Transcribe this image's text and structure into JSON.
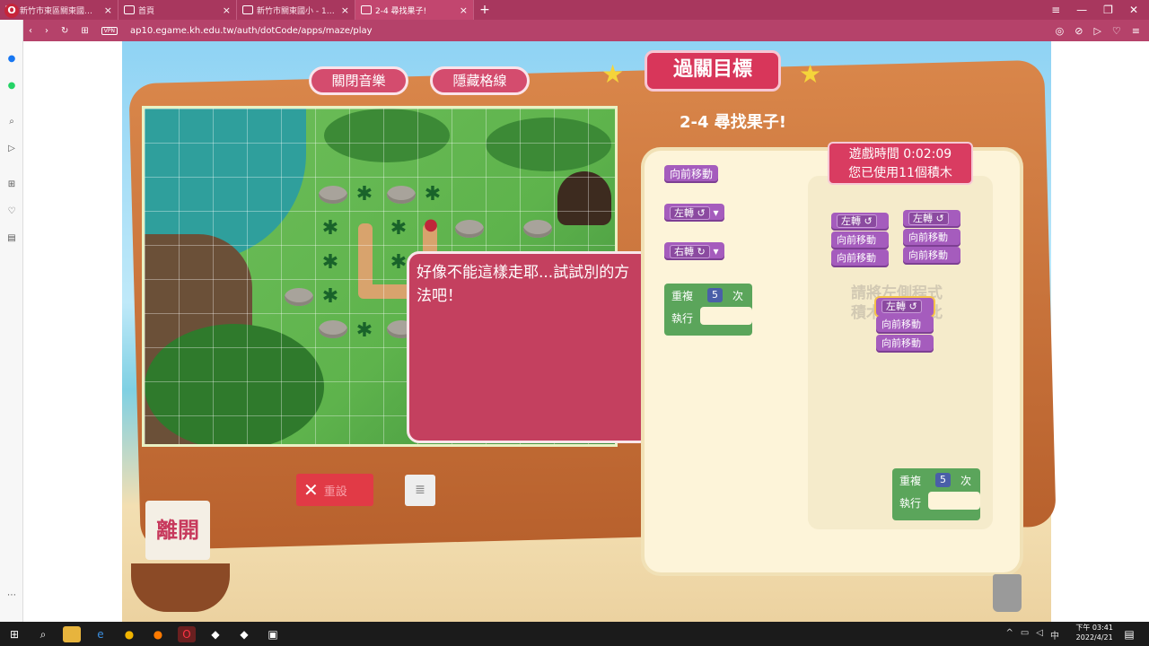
{
  "browser": {
    "tabs": [
      {
        "title": "新竹市東區關東國民小學 ...",
        "active": false
      },
      {
        "title": "首頁",
        "active": false
      },
      {
        "title": "新竹市關東國小 - 1Campu...",
        "active": false
      },
      {
        "title": "2-4 尋找果子!",
        "active": true
      }
    ],
    "new_tab": "+",
    "url": "ap10.egame.kh.edu.tw/auth/dotCode/apps/maze/play",
    "vpn_label": "VPN"
  },
  "game": {
    "music_button": "關閉音樂",
    "grid_button": "隱藏格線",
    "goal_banner": "過關目標",
    "level_title": "2-4 尋找果子!",
    "message": "好像不能這樣走耶...試試別的方法吧！",
    "timer_line1": "遊戲時間 0:02:09",
    "timer_line2": "您已使用11個積木",
    "hint_text": "請將左側程式積木拖曳到此",
    "reset_button": "重設",
    "leave_button": "離開"
  },
  "toolbox": {
    "forward": "向前移動",
    "turn_left": "左轉 ↺",
    "turn_right": "右轉 ↻",
    "repeat_label": "重複",
    "repeat_count": "5",
    "repeat_unit": "次",
    "do_label": "執行"
  },
  "workspace": {
    "stack1": [
      "左轉 ↺",
      "向前移動",
      "向前移動"
    ],
    "stack2": [
      "左轉 ↺",
      "向前移動",
      "向前移動"
    ],
    "stack3": [
      "左轉 ↺",
      "向前移動",
      "向前移動"
    ],
    "repeat_label": "重複",
    "repeat_count": "5",
    "repeat_unit": "次",
    "do_label": "執行"
  },
  "taskbar": {
    "time": "下午 03:41",
    "date": "2022/4/21"
  }
}
